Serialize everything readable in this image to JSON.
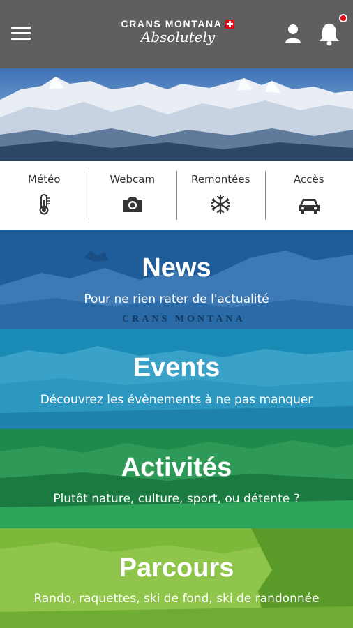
{
  "header": {
    "logo_line1": "CRANS MONTANA",
    "logo_line2": "Absolutely"
  },
  "icons": {
    "menu": "hamburger-icon",
    "user": "user-icon",
    "bell": "bell-icon",
    "meteo": "thermometer-icon",
    "webcam": "camera-icon",
    "remontees": "snowflake-icon",
    "acces": "car-icon"
  },
  "quick_access": [
    {
      "label": "Météo"
    },
    {
      "label": "Webcam"
    },
    {
      "label": "Remontées"
    },
    {
      "label": "Accès"
    }
  ],
  "tiles": [
    {
      "title": "News",
      "subtitle": "Pour ne rien rater de l'actualité",
      "color": "#1e5d9a"
    },
    {
      "title": "Events",
      "subtitle": "Découvrez les évènements à ne pas manquer",
      "color": "#1a8bb5"
    },
    {
      "title": "Activités",
      "subtitle": "Plutôt nature, culture, sport, ou détente ?",
      "color": "#1f8b4a"
    },
    {
      "title": "Parcours",
      "subtitle": "Rando, raquettes, ski de fond, ski de randonnée",
      "color": "#7cb83a"
    }
  ],
  "news_banner_text": "CRANS MONTANA",
  "colors": {
    "header_bg": "#5f5f5f",
    "notification": "#e30613"
  }
}
